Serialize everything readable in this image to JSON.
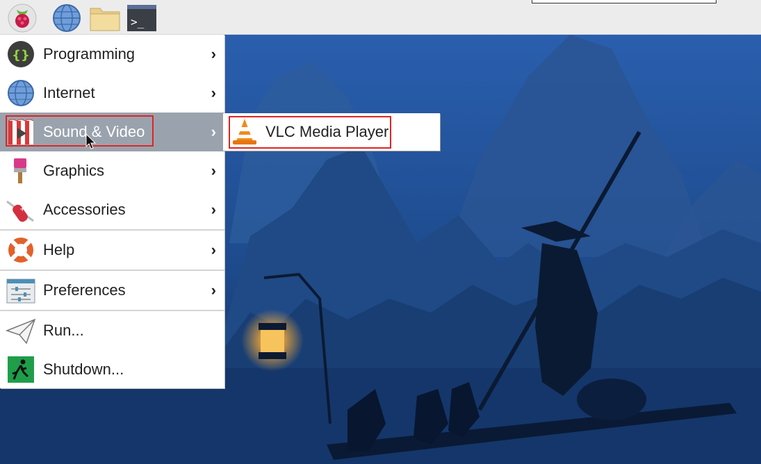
{
  "panel": {
    "launchers": [
      {
        "icon": "raspberry-pi-icon"
      },
      {
        "icon": "web-browser-icon"
      },
      {
        "icon": "file-manager-icon"
      },
      {
        "icon": "terminal-icon"
      }
    ]
  },
  "menu": {
    "items": [
      {
        "label": "Programming",
        "icon": "code-braces-icon",
        "arrow": "›"
      },
      {
        "label": "Internet",
        "icon": "globe-icon",
        "arrow": "›"
      },
      {
        "label": "Sound & Video",
        "icon": "play-media-icon",
        "arrow": "›",
        "active": true
      },
      {
        "label": "Graphics",
        "icon": "paint-brush-icon",
        "arrow": "›"
      },
      {
        "label": "Accessories",
        "icon": "swiss-knife-icon",
        "arrow": "›"
      },
      {
        "label": "Help",
        "icon": "lifebuoy-icon",
        "arrow": "›"
      },
      {
        "label": "Preferences",
        "icon": "sliders-icon",
        "arrow": "›"
      },
      {
        "label": "Run...",
        "icon": "paper-plane-icon"
      },
      {
        "label": "Shutdown...",
        "icon": "running-exit-icon"
      }
    ]
  },
  "submenu": {
    "items": [
      {
        "label": "VLC Media Player",
        "icon": "vlc-cone-icon"
      }
    ]
  },
  "colors": {
    "highlight_box": "#e02424",
    "menu_active_bg": "#9aa3ad",
    "panel_bg": "#ececec"
  }
}
